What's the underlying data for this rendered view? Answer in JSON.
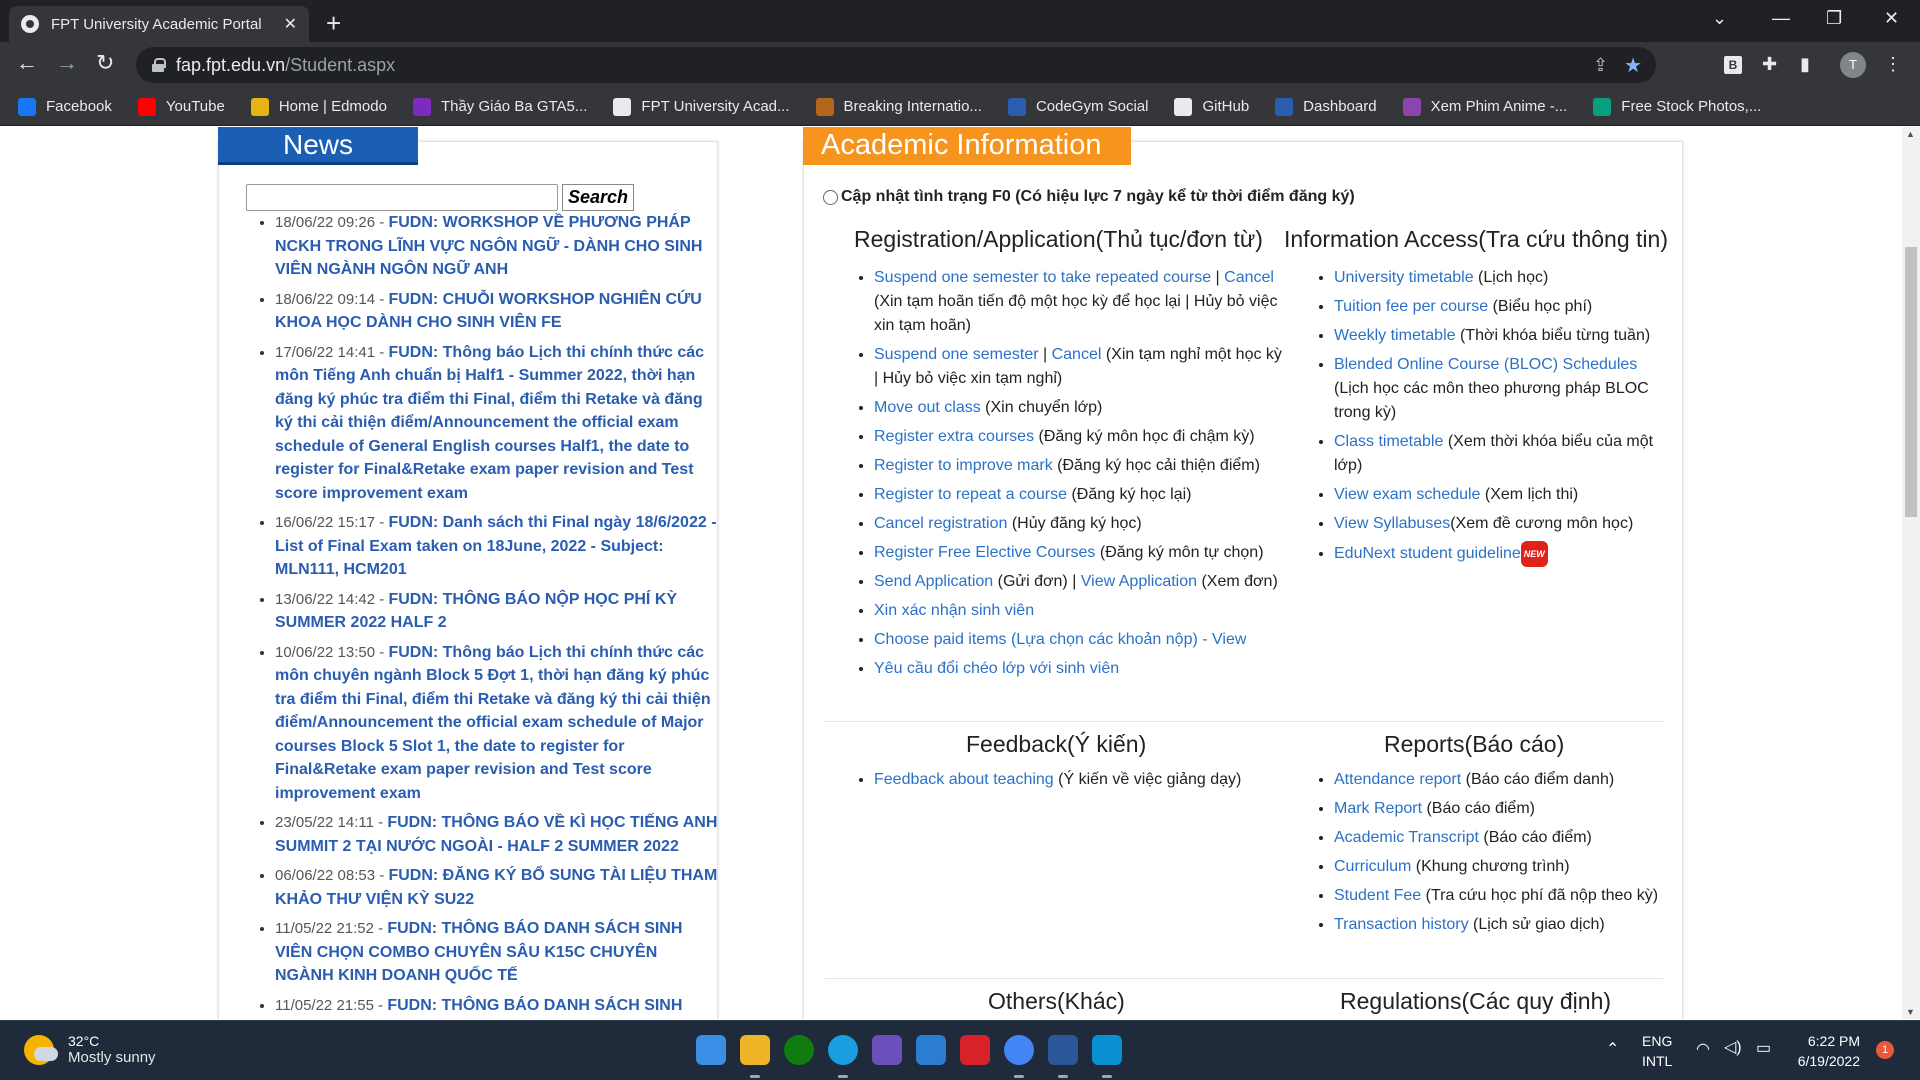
{
  "browser": {
    "tab_title": "FPT University Academic Portal",
    "url_host": "fap.fpt.edu.vn",
    "url_path": "/Student.aspx",
    "profile_initial": "T",
    "extension_label": "B",
    "bookmarks": [
      {
        "label": "Facebook",
        "color": "#1877f2"
      },
      {
        "label": "YouTube",
        "color": "#ff0000"
      },
      {
        "label": "Home | Edmodo",
        "color": "#e7b416"
      },
      {
        "label": "Thầy Giáo Ba GTA5...",
        "color": "#7b2cbf"
      },
      {
        "label": "FPT University Acad...",
        "color": "#e8eaed"
      },
      {
        "label": "Breaking Internatio...",
        "color": "#b5651d"
      },
      {
        "label": "CodeGym Social",
        "color": "#2a5db0"
      },
      {
        "label": "GitHub",
        "color": "#e8eaed"
      },
      {
        "label": "Dashboard",
        "color": "#2a5db0"
      },
      {
        "label": "Xem Phim Anime -...",
        "color": "#8e44ad"
      },
      {
        "label": "Free Stock Photos,...",
        "color": "#05a081"
      }
    ]
  },
  "news": {
    "heading": "News",
    "search_label": "Search",
    "items": [
      {
        "date": "18/06/22 09:26 - ",
        "title": "FUDN: WORKSHOP VỀ PHƯƠNG PHÁP NCKH TRONG LĨNH VỰC NGÔN NGỮ - DÀNH CHO SINH VIÊN NGÀNH NGÔN NGỮ ANH"
      },
      {
        "date": "18/06/22 09:14 - ",
        "title": "FUDN: CHUỖI WORKSHOP NGHIÊN CỨU KHOA HỌC DÀNH CHO SINH VIÊN FE"
      },
      {
        "date": "17/06/22 14:41 - ",
        "title": "FUDN: Thông báo Lịch thi chính thức các môn Tiếng Anh chuẩn bị Half1 - Summer 2022, thời hạn đăng ký phúc tra điểm thi Final, điểm thi Retake và đăng ký thi cải thiện điểm/Announcement the official exam schedule of General English courses Half1, the date to register for Final&Retake exam paper revision and Test score improvement exam"
      },
      {
        "date": "16/06/22 15:17 - ",
        "title": "FUDN: Danh sách thi Final ngày 18/6/2022 - List of Final Exam taken on 18June, 2022 - Subject: MLN111, HCM201"
      },
      {
        "date": "13/06/22 14:42 - ",
        "title": "FUDN: THÔNG BÁO NỘP HỌC PHÍ KỲ SUMMER 2022 HALF 2"
      },
      {
        "date": "10/06/22 13:50 - ",
        "title": "FUDN: Thông báo Lịch thi chính thức các môn chuyên ngành Block 5 Đợt 1, thời hạn đăng ký phúc tra điểm thi Final, điểm thi Retake và đăng ký thi cải thiện điểm/Announcement the official exam schedule of Major courses Block 5 Slot 1, the date to register for Final&Retake exam paper revision and Test score improvement exam"
      },
      {
        "date": "23/05/22 14:11 - ",
        "title": "FUDN: THÔNG BÁO VỀ KÌ HỌC TIẾNG ANH SUMMIT 2 TẠI NƯỚC NGOÀI - HALF 2 SUMMER 2022"
      },
      {
        "date": "06/06/22 08:53 - ",
        "title": "FUDN: ĐĂNG KÝ BỔ SUNG TÀI LIỆU THAM KHẢO THƯ VIỆN KỲ SU22"
      },
      {
        "date": "11/05/22 21:52 - ",
        "title": "FUDN: THÔNG BÁO DANH SÁCH SINH VIÊN CHỌN COMBO CHUYÊN SÂU K15C CHUYÊN NGÀNH KINH DOANH QUỐC TẾ"
      },
      {
        "date": "11/05/22 21:55 - ",
        "title": "FUDN: THÔNG BÁO DANH SÁCH SINH"
      }
    ]
  },
  "academic": {
    "heading": "Academic Information",
    "f0_label": "Cập nhật tình trạng F0 (Có hiệu lực 7 ngày kể từ thời điểm đăng ký)",
    "registration": {
      "title": "Registration/Application(Thủ tục/đơn từ)",
      "items": [
        {
          "link": "Suspend one semester to take repeated course",
          "sep": " | ",
          "link2": "Cancel",
          "note": " (Xin tạm hoãn tiến độ một học kỳ để học lại | Hủy bỏ việc xin tạm hoãn)"
        },
        {
          "link": "Suspend one semester",
          "sep": " |  ",
          "link2": "Cancel",
          "note": " (Xin tạm nghỉ một học kỳ | Hủy bỏ việc xin tạm nghỉ)"
        },
        {
          "link": "Move out class",
          "note": " (Xin chuyển lớp)"
        },
        {
          "link": "Register extra courses",
          "note": " (Đăng ký môn học đi chậm kỳ)"
        },
        {
          "link": "Register to improve mark",
          "note": "  (Đăng ký học cải thiện điểm)"
        },
        {
          "link": "Register to repeat a course",
          "note": " (Đăng ký học lại)"
        },
        {
          "link": "Cancel registration",
          "note": " (Hủy đăng ký học)"
        },
        {
          "link": "Register Free Elective Courses",
          "note": " (Đăng ký môn tự chọn)"
        },
        {
          "link": "Send Application",
          "sep": " (Gửi đơn) |  ",
          "link2": "View Application",
          "note": " (Xem đơn)"
        },
        {
          "link": "Xin xác nhận sinh viên",
          "note": ""
        },
        {
          "link": "Choose paid items (Lựa chọn các khoản nộp) - View",
          "note": ""
        },
        {
          "link": "Yêu cầu đổi chéo lớp với sinh viên",
          "note": ""
        }
      ]
    },
    "info_access": {
      "title": "Information Access(Tra cứu thông tin)",
      "items": [
        {
          "link": "University timetable",
          "note": " (Lịch học)"
        },
        {
          "link": "Tuition fee per course",
          "note": " (Biểu học phí)"
        },
        {
          "link": "Weekly timetable",
          "note": " (Thời khóa biểu từng tuần)"
        },
        {
          "link": "Blended Online Course (BLOC) Schedules",
          "note": " (Lịch học các môn theo phương pháp BLOC trong kỳ)"
        },
        {
          "link": "Class timetable",
          "note": " (Xem thời khóa biểu của một lớp)"
        },
        {
          "link": "View exam schedule",
          "note": " (Xem lịch thi)"
        },
        {
          "link": "View Syllabuses",
          "note": "(Xem đề cương môn học)"
        },
        {
          "link": "EduNext student guideline",
          "note": ""
        }
      ],
      "new_badge": "NEW"
    },
    "feedback": {
      "title": "Feedback(Ý kiến)",
      "items": [
        {
          "link": "Feedback about teaching",
          "note": " (Ý kiến về việc giảng dạy)"
        }
      ]
    },
    "reports": {
      "title": "Reports(Báo cáo)",
      "items": [
        {
          "link": "Attendance report",
          "note": " (Báo cáo điểm danh)"
        },
        {
          "link": "Mark Report",
          "note": " (Báo cáo điểm)"
        },
        {
          "link": "Academic Transcript",
          "note": " (Báo cáo điểm)"
        },
        {
          "link": "Curriculum",
          "note": " (Khung chương trình)"
        },
        {
          "link": "Student Fee",
          "note": " (Tra cứu học phí đã nộp theo kỳ)"
        },
        {
          "link": "Transaction history",
          "note": " (Lịch sử giao dịch)"
        }
      ]
    },
    "others_title": "Others(Khác)",
    "regulations_title": "Regulations(Các quy định)"
  },
  "taskbar": {
    "temperature": "32°C",
    "weather": "Mostly sunny",
    "lang1": "ENG",
    "lang2": "INTL",
    "time": "6:22 PM",
    "date": "6/19/2022",
    "notification_count": "1",
    "icons": [
      {
        "name": "start",
        "color": "#3a8ee6"
      },
      {
        "name": "file-explorer",
        "color": "#f0b429"
      },
      {
        "name": "xbox",
        "color": "#107c10"
      },
      {
        "name": "edge",
        "color": "#1b9de2"
      },
      {
        "name": "app-purple",
        "color": "#6b4fbb"
      },
      {
        "name": "mail",
        "color": "#2b7cd3"
      },
      {
        "name": "garena",
        "color": "#d8222a"
      },
      {
        "name": "chrome",
        "color": "#4285f4"
      },
      {
        "name": "word",
        "color": "#2b579a"
      },
      {
        "name": "webstorm",
        "color": "#0b8fd3"
      }
    ]
  }
}
